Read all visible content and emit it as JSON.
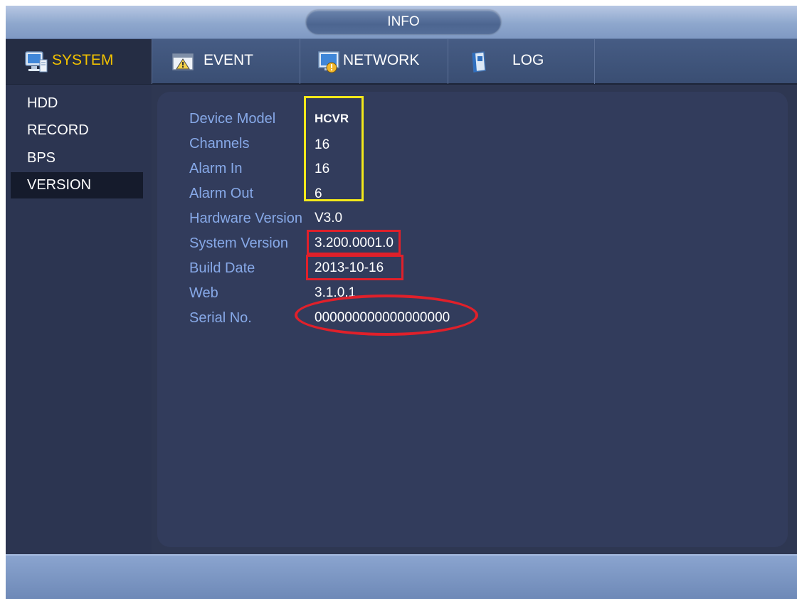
{
  "window": {
    "title": "INFO"
  },
  "tabs": [
    {
      "label": "SYSTEM",
      "icon": "monitor-icon",
      "active": true
    },
    {
      "label": "EVENT",
      "icon": "alarm-icon",
      "active": false
    },
    {
      "label": "NETWORK",
      "icon": "network-icon",
      "active": false
    },
    {
      "label": "LOG",
      "icon": "log-book-icon",
      "active": false
    }
  ],
  "sidebar": {
    "items": [
      {
        "label": "HDD",
        "active": false
      },
      {
        "label": "RECORD",
        "active": false
      },
      {
        "label": "BPS",
        "active": false
      },
      {
        "label": "VERSION",
        "active": true
      }
    ]
  },
  "version_info": {
    "rows": [
      {
        "label": "Device Model",
        "value": "HCVR"
      },
      {
        "label": "Channels",
        "value": "16"
      },
      {
        "label": "Alarm In",
        "value": "16"
      },
      {
        "label": "Alarm Out",
        "value": "6"
      },
      {
        "label": "Hardware Version",
        "value": "V3.0"
      },
      {
        "label": "System Version",
        "value": "3.200.0001.0"
      },
      {
        "label": "Build Date",
        "value": "2013-10-16"
      },
      {
        "label": "Web",
        "value": "3.1.0.1"
      },
      {
        "label": "Serial No.",
        "value": "000000000000000000"
      }
    ]
  },
  "colors": {
    "active_tab_text": "#f2c200",
    "label_text": "#87a9e8",
    "highlight_yellow": "#f3e81a",
    "highlight_red": "#e0202a"
  }
}
